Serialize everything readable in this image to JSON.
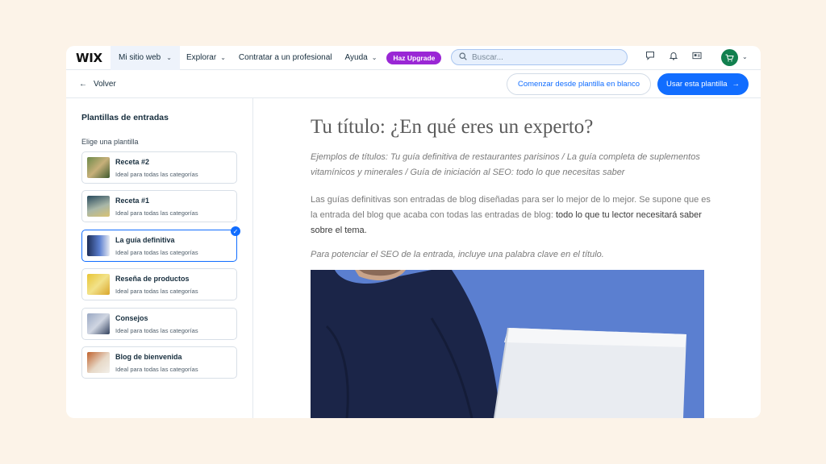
{
  "topnav": {
    "logo": "WIX",
    "site_tab": "Mi sitio web",
    "links": [
      "Explorar",
      "Contratar a un profesional",
      "Ayuda"
    ],
    "upgrade": "Haz Upgrade",
    "search_placeholder": "Buscar..."
  },
  "subbar": {
    "back": "Volver",
    "blank_template": "Comenzar desde plantilla en blanco",
    "use_template": "Usar esta plantilla"
  },
  "sidebar": {
    "title": "Plantillas de entradas",
    "subtitle": "Elige una plantilla",
    "templates": [
      {
        "name": "Receta #2",
        "desc": "Ideal para todas las categorías",
        "selected": false
      },
      {
        "name": "Receta #1",
        "desc": "Ideal para todas las categorías",
        "selected": false
      },
      {
        "name": "La guía definitiva",
        "desc": "Ideal para todas las categorías",
        "selected": true
      },
      {
        "name": "Reseña de productos",
        "desc": "Ideal para todas las categorías",
        "selected": false
      },
      {
        "name": "Consejos",
        "desc": "Ideal para todas las categorías",
        "selected": false
      },
      {
        "name": "Blog de bienvenida",
        "desc": "Ideal para todas las categorías",
        "selected": false
      }
    ]
  },
  "content": {
    "title": "Tu título: ¿En qué eres un experto?",
    "subtitle": "Ejemplos de títulos: Tu guía definitiva de restaurantes parisinos / La guía completa de suplementos vitamínicos y minerales / Guía de iniciación al SEO: todo lo que necesitas saber",
    "para_plain": "Las guías definitivas son entradas de blog diseñadas para ser lo mejor de lo mejor.  Se supone que es la entrada del blog que acaba con todas las entradas de blog: ",
    "para_bold": "todo lo que tu lector necesitará saber sobre el tema.",
    "hint": "Para potenciar el SEO de la entrada, incluye una palabra clave en el título."
  },
  "colors": {
    "accent": "#116dff",
    "upgrade": "#9a27d5",
    "avatar": "#12804f",
    "background": "#fcf3e8"
  }
}
